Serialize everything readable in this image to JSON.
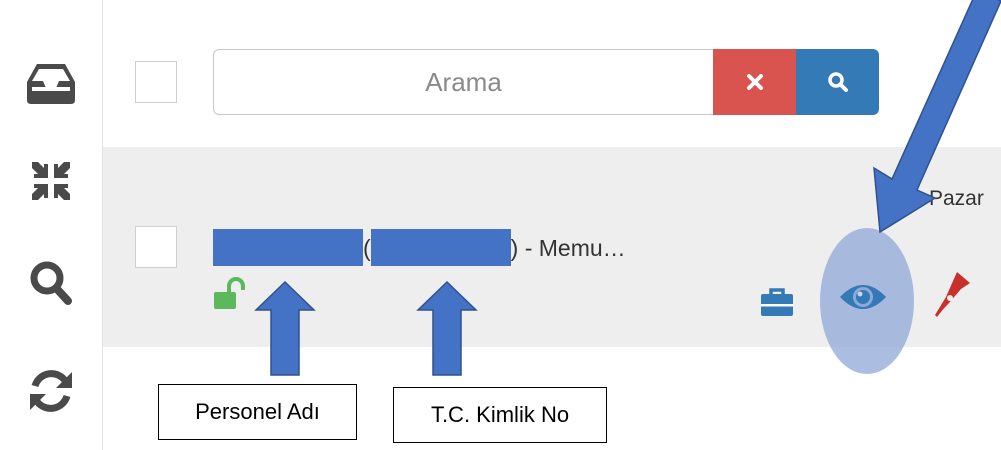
{
  "search": {
    "placeholder": "Arama"
  },
  "row": {
    "text_paren_open": "(",
    "text_suffix": ") - Memu…",
    "date_label": "Pazar"
  },
  "annotations": {
    "personel_label": "Personel Adı",
    "tc_label": "T.C. Kimlik No"
  },
  "icons": {
    "sidebar": [
      "inbox-tray-icon",
      "compress-icon",
      "search-icon",
      "refresh-icon"
    ],
    "row_actions": [
      "briefcase-icon",
      "eye-icon",
      "signature-pen-icon"
    ],
    "status": "unlock-icon"
  },
  "colors": {
    "danger": "#d9534f",
    "primary": "#337ab7",
    "success": "#5cb85c",
    "pen_red": "#c9302c",
    "annotation_blue": "#4472c4"
  }
}
